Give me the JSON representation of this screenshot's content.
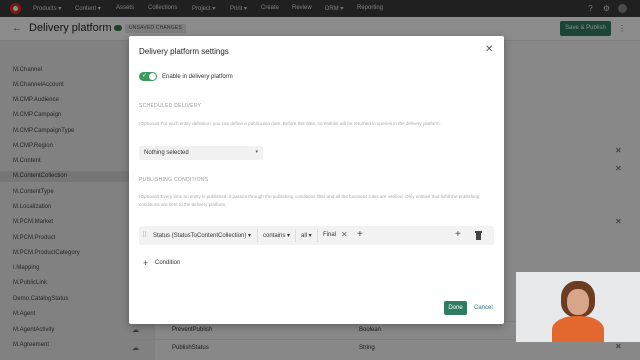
{
  "topnav": {
    "items": [
      "Products",
      "Content",
      "Assets",
      "Collections",
      "Project",
      "Print",
      "Create",
      "Review",
      "DRM",
      "Reporting"
    ],
    "dropdown_suffix": "▾"
  },
  "header": {
    "title": "Delivery platform",
    "status_badge": "UNSAVED CHANGES",
    "save_publish": "Save & Publish"
  },
  "sidebar": {
    "items": [
      "M.Channel",
      "M.ChannelAccount",
      "M.CMP.Audience",
      "M.CMP.Campaign",
      "M.CMP.CampaignType",
      "M.CMP.Region",
      "M.Content",
      "M.ContentCollection",
      "M.ContentType",
      "M.Localization",
      "M.PCM.Market",
      "M.PCM.Product",
      "M.PCM.ProductCategory",
      "I.Mapping",
      "M.PublicLink",
      "Demo.CatalogStatus",
      "M.Agent",
      "M.AgentActivity",
      "M.Agreement"
    ],
    "active_index": 7
  },
  "grid": {
    "rows": [
      {
        "name": "PreventPublish",
        "type": "Boolean"
      },
      {
        "name": "PublishStatus",
        "type": "String"
      }
    ]
  },
  "dialog": {
    "title": "Delivery platform settings",
    "enable_label": "Enable in delivery platform",
    "enabled": true,
    "scheduled_heading": "SCHEDULED DELIVERY",
    "scheduled_hint": "(Optional) For each entity definition, you can define a publication date. Before this date, no entities will be returned in queries in the delivery platform.",
    "select_value": "Nothing selected",
    "conditions_heading": "PUBLISHING CONDITIONS",
    "conditions_hint": "(Optional) Every time an entity is published, it passes through the publishing conditions filter and all the business rules are verified. Only entities that fulfill the publishing conditions are sent to the delivery platform.",
    "condition": {
      "field": "Status (StatusToContentCollection)",
      "operator": "contains",
      "quantifier": "all",
      "value": "Final"
    },
    "add_condition": "Condition",
    "done": "Done",
    "cancel": "Cancel"
  }
}
